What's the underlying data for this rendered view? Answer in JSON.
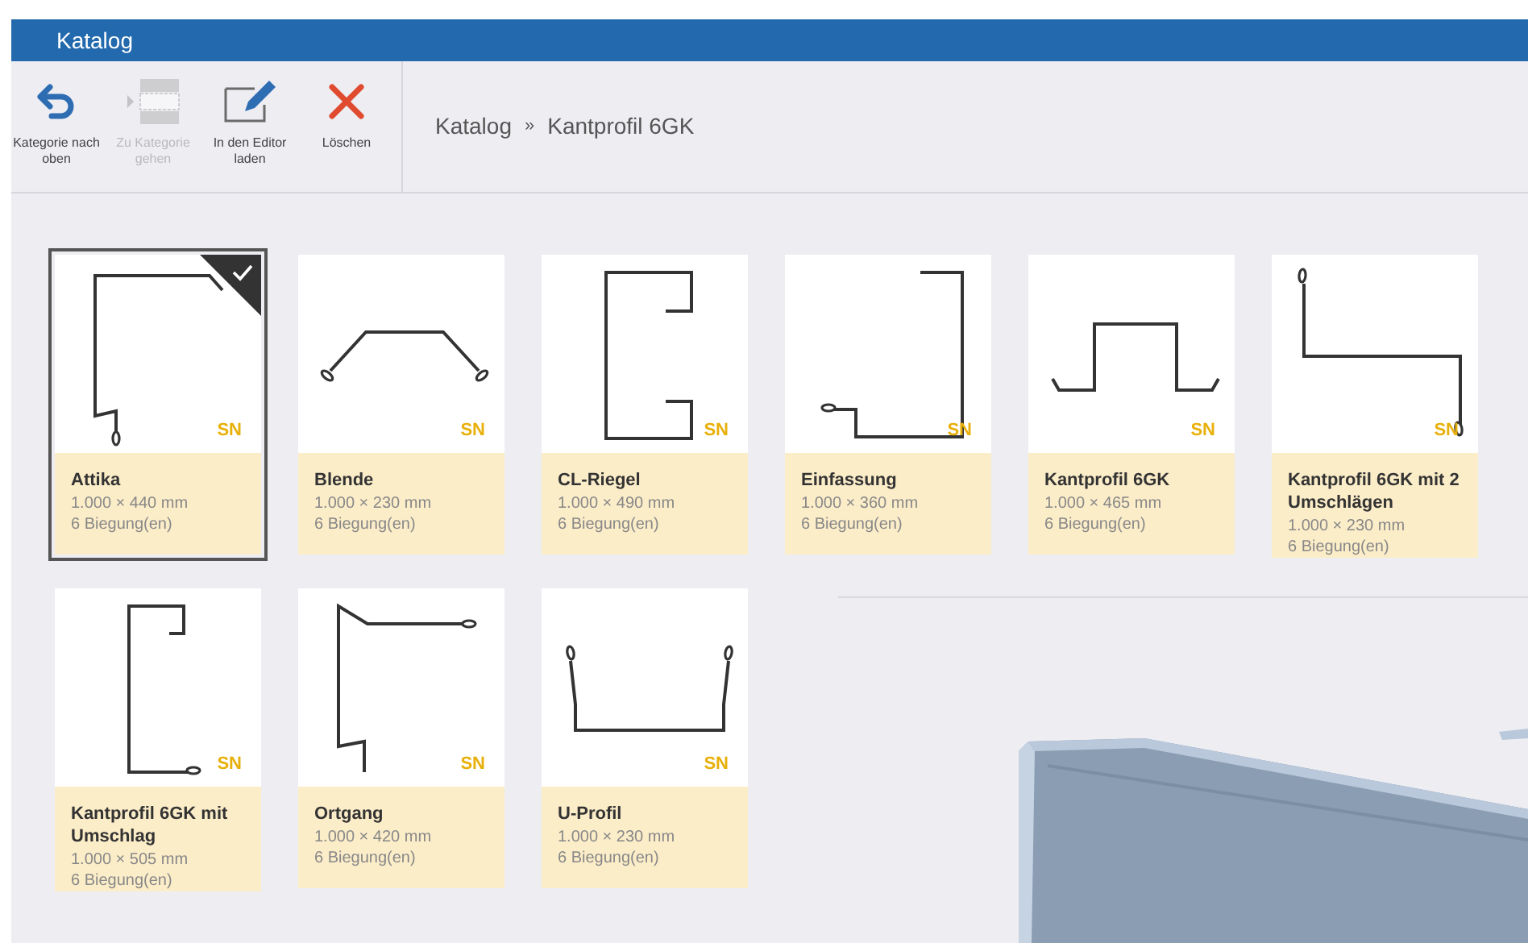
{
  "window": {
    "title": "Katalog"
  },
  "toolbar": [
    {
      "kind": "up",
      "label": "Kategorie nach oben",
      "disabled": false
    },
    {
      "kind": "goto",
      "label": "Zu Kategorie gehen",
      "disabled": true
    },
    {
      "kind": "edit",
      "label": "In den Editor laden",
      "disabled": false
    },
    {
      "kind": "delete",
      "label": "Löschen",
      "disabled": false
    }
  ],
  "breadcrumb": [
    "Katalog",
    "»",
    "Kantprofil 6GK"
  ],
  "items": [
    {
      "kind": "attika",
      "name": "Attika",
      "size": "1.000 × 440 mm",
      "bends": "6 Biegung(en)",
      "badge": "SN",
      "selected": true
    },
    {
      "kind": "blende",
      "name": "Blende",
      "size": "1.000 × 230 mm",
      "bends": "6 Biegung(en)",
      "badge": "SN",
      "selected": false
    },
    {
      "kind": "riegel",
      "name": "CL-Riegel",
      "size": "1.000 × 490 mm",
      "bends": "6 Biegung(en)",
      "badge": "SN",
      "selected": false
    },
    {
      "kind": "einfassung",
      "name": "Einfassung",
      "size": "1.000 × 360 mm",
      "bends": "6 Biegung(en)",
      "badge": "SN",
      "selected": false
    },
    {
      "kind": "hat",
      "name": "Kantprofil 6GK",
      "size": "1.000 × 465 mm",
      "bends": "6 Biegung(en)",
      "badge": "SN",
      "selected": false
    },
    {
      "kind": "zed",
      "name": "Kantprofil 6GK mit 2 Umschlägen",
      "size": "1.000 × 230 mm",
      "bends": "6 Biegung(en)",
      "badge": "SN",
      "selected": false
    },
    {
      "kind": "channel",
      "name": "Kantprofil 6GK mit Umschlag",
      "size": "1.000 × 505 mm",
      "bends": "6 Biegung(en)",
      "badge": "SN",
      "selected": false
    },
    {
      "kind": "ortgang",
      "name": "Ortgang",
      "size": "1.000 × 420 mm",
      "bends": "6 Biegung(en)",
      "badge": "SN",
      "selected": false
    },
    {
      "kind": "u",
      "name": "U-Profil",
      "size": "1.000 × 230 mm",
      "bends": "6 Biegung(en)",
      "badge": "SN",
      "selected": false
    }
  ]
}
